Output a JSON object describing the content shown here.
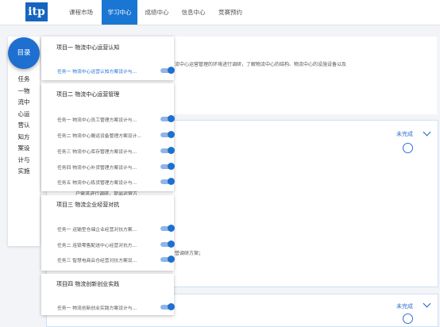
{
  "logo": "itp",
  "nav": [
    "课程市场",
    "学习中心",
    "成绩中心",
    "信息中心",
    "竞赛预约"
  ],
  "nav_active": 1,
  "background": {
    "intro_text": "流中心运营管理的环境进行调研，了解物流中心的结构、物流中心的设施设备以及",
    "status_1": "未完成",
    "overlap_text": "户需求进行调研，提出运营方",
    "plan_text": "營调研方案；",
    "status_2": "未完成"
  },
  "sidebar": {
    "menu_label": "目录",
    "current_task": "任务一物流中心运营认知方案设计与实施"
  },
  "projects": [
    {
      "title": "项目一 物流中心运营认知",
      "tasks": [
        {
          "label": "任务一 物流中心运营认知方案设计与...",
          "active": true
        }
      ]
    },
    {
      "title": "项目二 物流中心运营管理",
      "tasks": [
        {
          "label": "任务一 物流中心员工管理方案设计与...",
          "active": false
        },
        {
          "label": "任务二 物流中心搬运设备管理方案设计...",
          "active": false
        },
        {
          "label": "任务三 物流中心库存管理方案设计与...",
          "active": false
        },
        {
          "label": "任务四 物流中心补货管理方案设计与...",
          "active": false
        },
        {
          "label": "任务五 物流中心拣货管理方案设计与...",
          "active": false
        }
      ]
    },
    {
      "title": "项目三 物流企业经营对抗",
      "tasks": [
        {
          "label": "任务一 运输型仓储企业经营对抗方案...",
          "active": false
        },
        {
          "label": "任务二 连锁零售配送中心经营对抗方...",
          "active": false
        },
        {
          "label": "任务三 智慧电商云仓经营对抗方案设...",
          "active": false
        }
      ]
    },
    {
      "title": "项目四 物流创新创业实践",
      "tasks": [
        {
          "label": "任务一 物流创新创业实践方案设计与...",
          "active": false
        }
      ]
    }
  ],
  "colors": {
    "primary": "#1e6fd0",
    "nav_active": "#1976d2",
    "status": "#2f6fd1"
  }
}
